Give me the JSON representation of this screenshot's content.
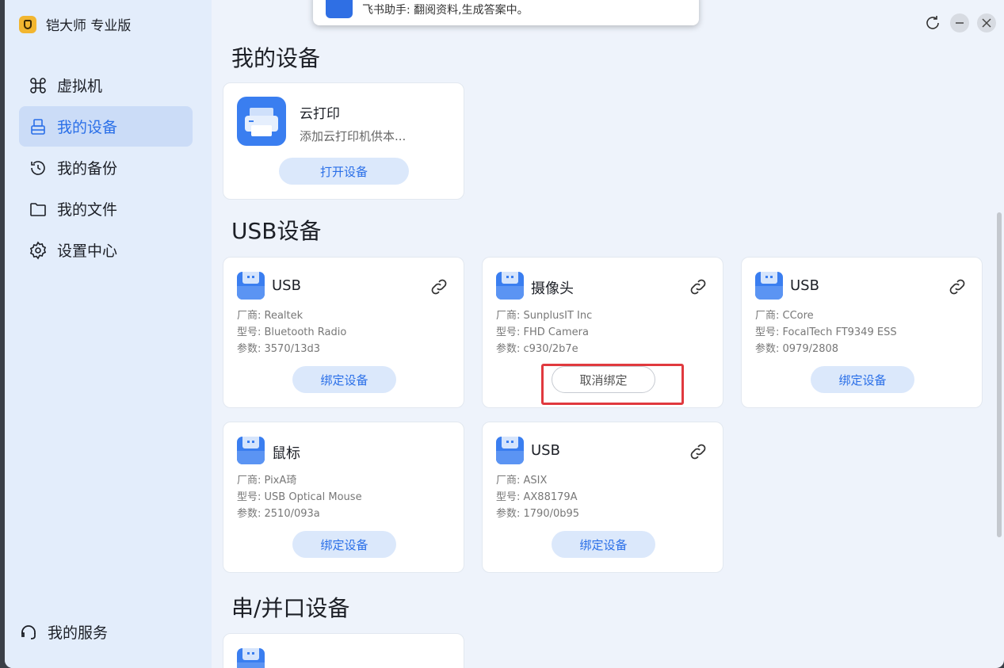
{
  "app": {
    "title": "铠大师 专业版"
  },
  "sidebar": {
    "items": [
      {
        "label": "虚拟机",
        "icon": "command-icon",
        "active": false
      },
      {
        "label": "我的设备",
        "icon": "device-icon",
        "active": true
      },
      {
        "label": "我的备份",
        "icon": "history-icon",
        "active": false
      },
      {
        "label": "我的文件",
        "icon": "folder-icon",
        "active": false
      },
      {
        "label": "设置中心",
        "icon": "gear-icon",
        "active": false
      }
    ],
    "service_label": "我的服务"
  },
  "toast": {
    "text": "飞书助手: 翻阅资料,生成答案中。"
  },
  "sections": {
    "my_devices": "我的设备",
    "usb": "USB设备",
    "serial": "串/并口设备"
  },
  "cloud_print": {
    "title": "云打印",
    "desc": "添加云打印机供本...",
    "button": "打开设备"
  },
  "usb_devices": [
    {
      "name": "USB",
      "vendor": "厂商: Realtek",
      "model": "型号: Bluetooth Radio",
      "params": "参数: 3570/13d3",
      "button": "绑定设备",
      "has_link": true
    },
    {
      "name": "摄像头",
      "vendor": "厂商: SunplusIT Inc",
      "model": "型号: FHD Camera",
      "params": "参数: c930/2b7e",
      "button": "取消绑定",
      "has_link": true
    },
    {
      "name": "USB",
      "vendor": "厂商: CCore",
      "model": "型号: FocalTech FT9349 ESS",
      "params": "参数: 0979/2808",
      "button": "绑定设备",
      "has_link": true
    },
    {
      "name": "鼠标",
      "vendor": "厂商: PixA琦",
      "model": "型号: USB Optical Mouse",
      "params": "参数: 2510/093a",
      "button": "绑定设备",
      "has_link": false
    },
    {
      "name": "USB",
      "vendor": "厂商: ASIX",
      "model": "型号: AX88179A",
      "params": "参数: 1790/0b95",
      "button": "绑定设备",
      "has_link": true
    }
  ],
  "colors": {
    "accent": "#2a6fe8",
    "highlight": "#e0393e",
    "sidebar_bg": "#e3edfb",
    "content_bg": "#eef3fb"
  }
}
